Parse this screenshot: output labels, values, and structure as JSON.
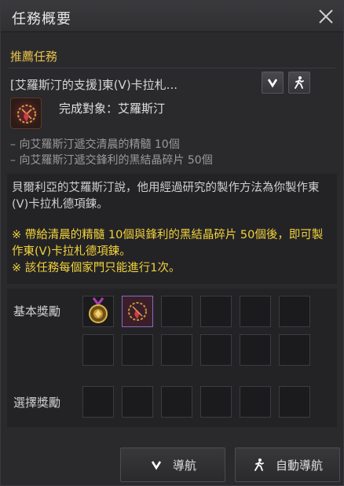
{
  "window": {
    "title": "任務概要"
  },
  "section": {
    "recommended": "推薦任務"
  },
  "quest": {
    "title": "[艾羅斯汀的支援]東(V)卡拉札...",
    "target": "完成對象：艾羅斯汀",
    "objectives": [
      "– 向艾羅斯汀遞交清晨的精髓 10個",
      "– 向艾羅斯汀遞交鋒利的黑結晶碎片 50個"
    ]
  },
  "description": {
    "text": "貝爾利亞的艾羅斯汀說，他用經過研究的製作方法為你製作東(V)卡拉札德項鍊。",
    "notes": [
      "※ 帶給清晨的精髓 10個與鋒利的黑結晶碎片 50個後，即可製作東(V)卡拉札德項鍊。",
      "※ 該任務每個家門只能進行1次。"
    ]
  },
  "rewards": {
    "basic_label": "基本獎勵",
    "choice_label": "選擇獎勵",
    "basic_items": [
      "medal-icon",
      "necklace-icon"
    ]
  },
  "buttons": {
    "navigate": "導航",
    "auto_navigate": "自動導航"
  },
  "colors": {
    "accent": "#e9c24a",
    "note": "#f2d23a",
    "background": "#2a2a2d"
  }
}
